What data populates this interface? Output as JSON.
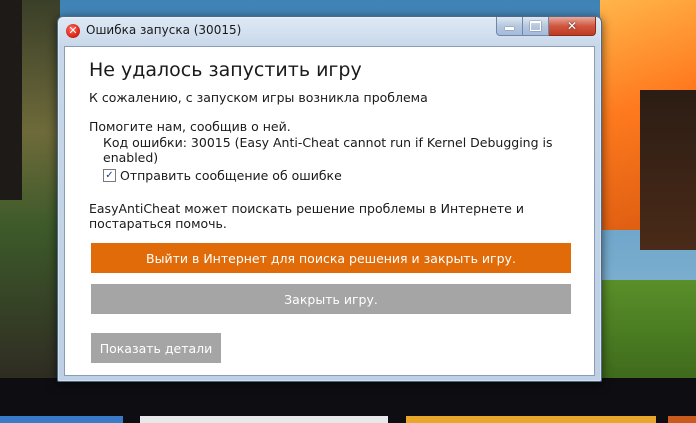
{
  "window": {
    "title": "Ошибка запуска (30015)",
    "controls": {
      "minimize": "",
      "maximize": "",
      "close": "✕"
    }
  },
  "dialog": {
    "heading": "Не удалось запустить игру",
    "intro": "К сожалению, с запуском игры возникла проблема",
    "help_prompt": "Помогите нам, сообщив о ней.",
    "error_code": "Код ошибки: 30015 (Easy Anti-Cheat cannot run if Kernel Debugging is enabled)",
    "send_report": {
      "label": "Отправить сообщение об ошибке",
      "checked": true,
      "check_glyph": "✓"
    },
    "search_note": "EasyAntiCheat может поискать решение проблемы в Интернете и постараться помочь.",
    "buttons": {
      "search_online": "Выйти в Интернет для поиска решения и закрыть игру.",
      "close_game": "Закрыть игру.",
      "show_details": "Показать детали"
    }
  },
  "colors": {
    "primary_button": "#e06b08",
    "secondary_button": "#a5a5a5",
    "error_icon": "#d21f12"
  }
}
